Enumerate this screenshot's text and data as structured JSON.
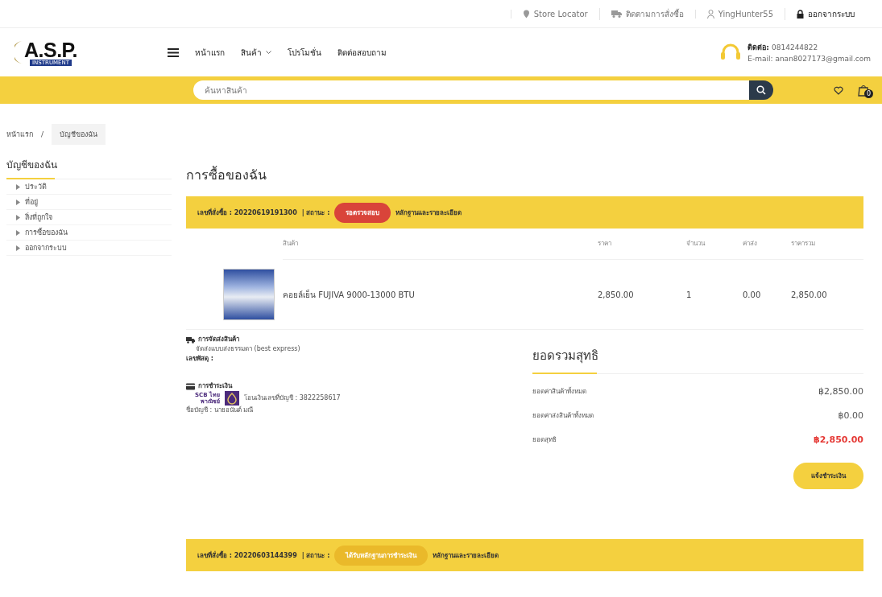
{
  "top_links": [
    {
      "kind": "pin",
      "label": "Store Locator"
    },
    {
      "kind": "truck",
      "label": "ติดตามการสั่งซื้อ"
    },
    {
      "kind": "user",
      "label": "YingHunter55"
    },
    {
      "kind": "lock",
      "label": "ออกจากระบบ"
    }
  ],
  "logo": {
    "title": "A.S.P.",
    "subtitle": "INSTRUMENT"
  },
  "nav": [
    {
      "label": "หน้าแรก",
      "dropdown": false
    },
    {
      "label": "สินค้า",
      "dropdown": true
    },
    {
      "label": "โปรโมชั่น",
      "dropdown": false
    },
    {
      "label": "ติดต่อสอบถาม",
      "dropdown": false
    }
  ],
  "contact": {
    "phone_label": "ติดต่อ:",
    "phone": "0814244822",
    "email": "E-mail: anan8027173@gmail.com"
  },
  "search": {
    "placeholder": "ค้นหาสินค้า"
  },
  "cart": {
    "count": "0"
  },
  "breadcrumb": [
    "หน้าแรก",
    "บัญชีของฉัน"
  ],
  "breadcrumb_separator": "/",
  "sidebar": {
    "title": "บัญชีของฉัน",
    "items": [
      "ประวัติ",
      "ที่อยู่",
      "สิ่งที่ถูกใจ",
      "การซื้อของฉัน",
      "ออกจากระบบ"
    ]
  },
  "page_title": "การซื้อของฉัน",
  "orders": [
    {
      "number_label": "เลขที่สั่งซื้อ : 20220619191300",
      "status_label": "| สถานะ :",
      "status": "รอตรวจสอบ",
      "color": "#d9443a",
      "details_link": "หลักฐานและรายละเอียด",
      "columns": [
        "สินค้า",
        "ราคา",
        "จำนวน",
        "ค่าส่ง",
        "ราคารวม"
      ],
      "items": [
        {
          "name": "คอยล์เย็น FUJIVA 9000-13000 BTU",
          "price": "2,850.00",
          "qty": "1",
          "shipping": "0.00",
          "total": "2,850.00"
        }
      ],
      "delivery": {
        "title": "การจัดส่งสินค้า",
        "method": "จัดส่งแบบส่งธรรมดา (best express)",
        "tracking": "เลขพัสดุ :"
      },
      "payment": {
        "title": "การชำระเงิน",
        "bank_logo": "SCB ไทยพาณิชย์",
        "account": "โอนเงินเลขที่บัญชี : 3822258617",
        "account_name": "ชื่อบัญชี : นายอนันต์ มณี"
      },
      "summary": {
        "title": "ยอดรวมสุทธิ",
        "rows": [
          {
            "label": "ยอดค่าสินค้าทั้งหมด",
            "value": "฿2,850.00",
            "highlight": false
          },
          {
            "label": "ยอดค่าส่งสินค้าทั้งหมด",
            "value": "฿0.00",
            "highlight": false
          },
          {
            "label": "ยอดสุทธิ",
            "value": "฿2,850.00",
            "highlight": true
          }
        ],
        "button": "แจ้งชำระเงิน"
      }
    },
    {
      "number_label": "เลขที่สั่งซื้อ : 20220603144399",
      "status_label": "| สถานะ :",
      "status": "ได้รับหลักฐานการชำระเงิน",
      "color": "#eab92a",
      "details_link": "หลักฐานและรายละเอียด"
    }
  ]
}
